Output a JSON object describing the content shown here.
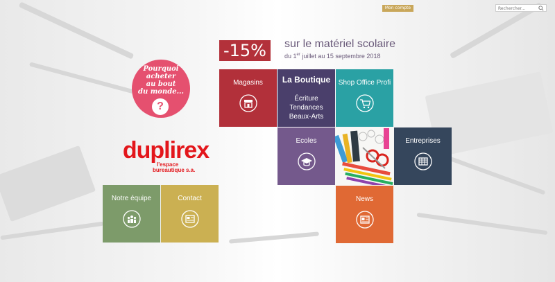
{
  "header": {
    "account_label": "Mon compte",
    "search_placeholder": "Rechercher..."
  },
  "promo": {
    "badge": "-15%",
    "title": "sur le matériel scolaire",
    "dates_prefix": "du 1",
    "dates_sup": "er",
    "dates_suffix": " juillet au 15 septembre 2018"
  },
  "bubble": {
    "text_lines": [
      "Pourquoi",
      "acheter",
      "au bout",
      "du monde..."
    ],
    "question_mark": "?"
  },
  "logo": {
    "main": "duplirex",
    "sub_line1": "l'espace",
    "sub_line2": "bureautique s.a."
  },
  "tiles": {
    "magasins": {
      "label": "Magasins",
      "icon": "store-icon",
      "color": "#b2303a"
    },
    "boutique": {
      "title": "La Boutique",
      "items": [
        "Écriture",
        "Tendances",
        "Beaux-Arts"
      ],
      "color": "#4a3f6b"
    },
    "shop_office": {
      "label": "Shop Office Profi",
      "icon": "cart-icon",
      "color": "#2aa1a4"
    },
    "ecoles": {
      "label": "Ecoles",
      "icon": "graduation-cap-icon",
      "color": "#74598c"
    },
    "entreprises": {
      "label": "Entreprises",
      "icon": "building-icon",
      "color": "#35465c"
    },
    "equipe": {
      "label": "Notre équipe",
      "icon": "team-icon",
      "color": "#7d9b6a"
    },
    "contact": {
      "label": "Contact",
      "icon": "contact-card-icon",
      "color": "#cbb052"
    },
    "news": {
      "label": "News",
      "icon": "newspaper-icon",
      "color": "#e06934"
    }
  }
}
